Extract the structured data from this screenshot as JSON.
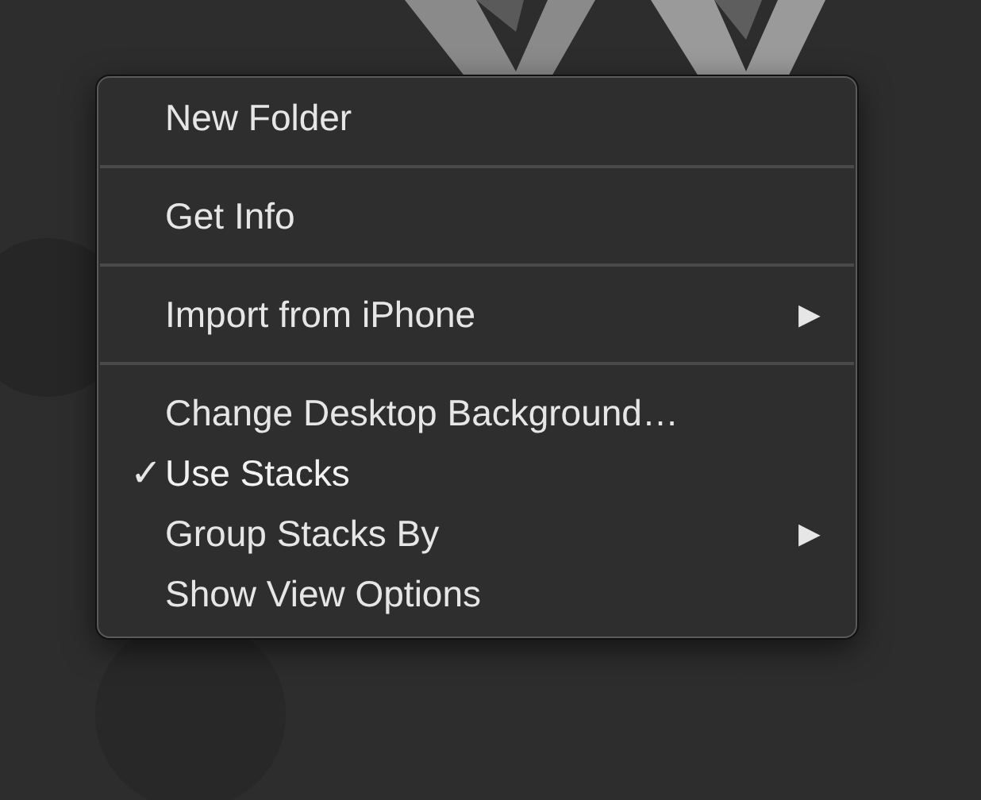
{
  "menu": {
    "sections": [
      [
        {
          "label": "New Folder",
          "checked": false
        }
      ],
      [
        {
          "label": "Get Info",
          "checked": false
        }
      ],
      [
        {
          "label": "Import from iPhone",
          "checked": false,
          "submenu": "▶"
        }
      ],
      [
        {
          "label": "Change Desktop Background…",
          "checked": false
        },
        {
          "label": "Use Stacks",
          "checked": true,
          "check": "✓"
        },
        {
          "label": "Group Stacks By",
          "checked": false,
          "submenu": "▶"
        },
        {
          "label": "Show View Options",
          "checked": false
        }
      ]
    ]
  }
}
